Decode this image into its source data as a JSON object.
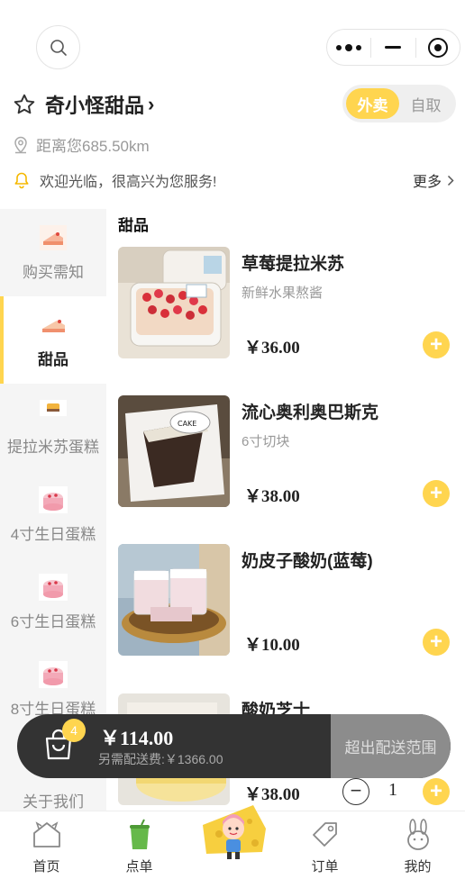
{
  "header": {
    "search_icon": "search-icon",
    "capsule": {
      "menu_icon": "more-dots-icon",
      "minimize_icon": "minimize-icon",
      "close_icon": "target-close-icon"
    }
  },
  "store": {
    "name": "奇小怪甜品",
    "chevron": "›",
    "modes": [
      "外卖",
      "自取"
    ],
    "active_mode": "外卖",
    "distance": "距离您685.50km",
    "notice": "欢迎光临，很高兴为您服务!",
    "more_label": "更多"
  },
  "sidebar": {
    "items": [
      {
        "label": "购买需知",
        "icon": "cake-slice-icon",
        "active": false
      },
      {
        "label": "甜品",
        "icon": "cake-slice-icon",
        "active": true
      },
      {
        "label": "提拉米苏蛋糕",
        "icon": "tiramisu-icon",
        "active": false
      },
      {
        "label": "4寸生日蛋糕",
        "icon": "birthday-cake-icon",
        "active": false
      },
      {
        "label": "6寸生日蛋糕",
        "icon": "birthday-cake-icon",
        "active": false
      },
      {
        "label": "8寸生日蛋糕",
        "icon": "birthday-cake-icon",
        "active": false
      },
      {
        "label": "关于我们",
        "icon": "",
        "active": false
      }
    ]
  },
  "main": {
    "section_title": "甜品",
    "items": [
      {
        "name": "草莓提拉米苏",
        "desc": "新鲜水果熬酱",
        "price": "￥36.00",
        "qty": null
      },
      {
        "name": "流心奥利奥巴斯克",
        "desc": "6寸切块",
        "price": "￥38.00",
        "qty": null
      },
      {
        "name": "奶皮子酸奶(蓝莓)",
        "desc": "",
        "price": "￥10.00",
        "qty": null
      },
      {
        "name": "酸奶芝士",
        "desc": "",
        "price": "￥38.00",
        "qty": "1"
      }
    ],
    "add_symbol": "+",
    "minus_symbol": "−"
  },
  "cart": {
    "count": "4",
    "total": "￥114.00",
    "fee_note": "另需配送费:￥1366.00",
    "action": "超出配送范围"
  },
  "tabbar": {
    "tabs": [
      {
        "label": "首页",
        "icon": "house-icon"
      },
      {
        "label": "点单",
        "icon": "drink-cup-icon"
      },
      {
        "label": "",
        "icon": "mascot-icon"
      },
      {
        "label": "订单",
        "icon": "tag-icon"
      },
      {
        "label": "我的",
        "icon": "bunny-icon"
      }
    ]
  },
  "colors": {
    "accent": "#ffd54f",
    "cart_bg": "#333333",
    "cart_disabled": "#8c8c8c",
    "sidebar_bg": "#f5f5f5"
  }
}
